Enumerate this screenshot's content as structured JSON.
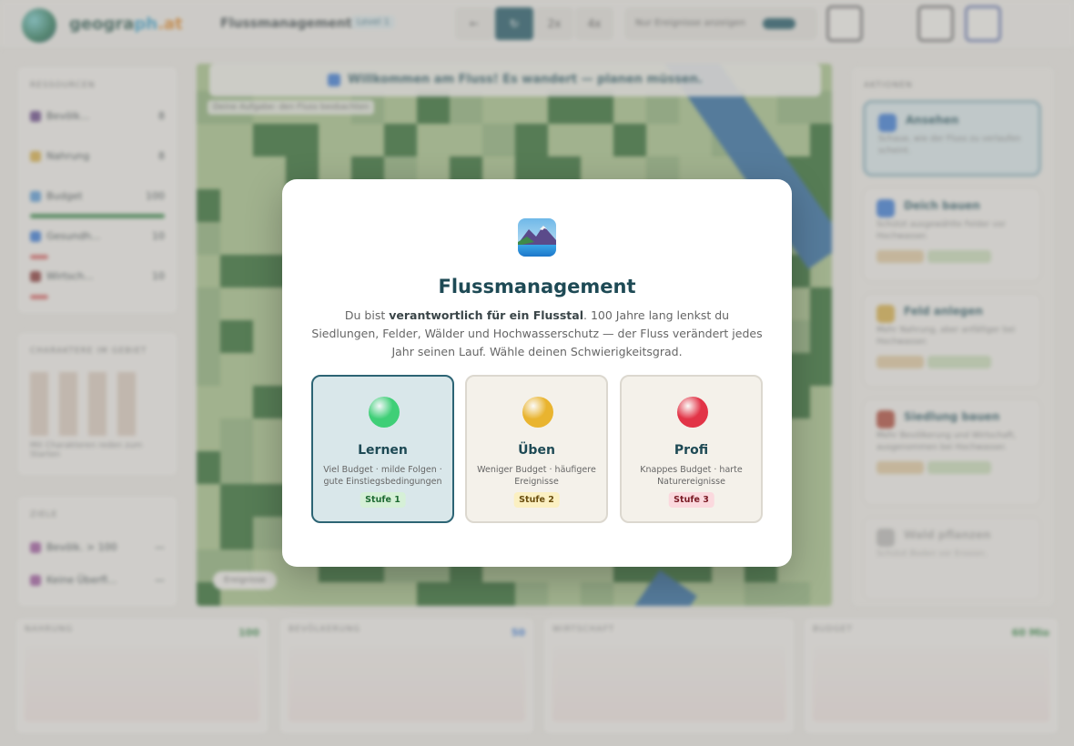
{
  "header": {
    "logo": {
      "a": "geogra",
      "b": "ph",
      "c": ".at"
    },
    "title": "Flussmanagement",
    "badge": "Level 1",
    "controls": [
      "←",
      "↻",
      "2x",
      "4x"
    ],
    "toggle_label": "Nur Ereignisse anzeigen"
  },
  "sidebar": {
    "resources_heading": "RESSOURCEN",
    "resources": [
      {
        "label": "Bevölk...",
        "value": "8",
        "color": "#6a4a8a"
      },
      {
        "label": "Nahrung",
        "value": "8",
        "color": "#d8b04a"
      },
      {
        "label": "Budget",
        "value": "100",
        "color": "#5b9bd5"
      },
      {
        "label": "Gesundh...",
        "value": "10",
        "color": "#3a7ad5"
      },
      {
        "label": "Wirtsch...",
        "value": "10",
        "color": "#8a3a3a"
      }
    ],
    "chars_heading": "CHARAKTERE IM GEBIET",
    "chars_note": "Mit Charakteren reden zum Starten",
    "goals_heading": "ZIELE",
    "goals": [
      {
        "label": "Bevölk. > 100",
        "value": "—"
      },
      {
        "label": "Keine Überfl...",
        "value": "—"
      }
    ]
  },
  "map": {
    "banner": "Willkommen am Fluss! Es wandert — planen müssen.",
    "corner_label": "Deine Aufgabe: den Fluss beobachten",
    "bottom_chip": "Ereignisse"
  },
  "actions": {
    "heading": "AKTIONEN",
    "items": [
      {
        "title": "Ansehen",
        "text": "Schaue, wie der Fluss zu verlaufen scheint."
      },
      {
        "title": "Deich bauen",
        "text": "Schützt ausgewählte Felder vor Hochwasser."
      },
      {
        "title": "Feld anlegen",
        "text": "Mehr Nahrung, aber anfälliger bei Hochwasser."
      },
      {
        "title": "Siedlung bauen",
        "text": "Mehr Bevölkerung und Wirtschaft, ausgenommen bei Hochwasser."
      },
      {
        "title": "Wald pflanzen",
        "text": "Schützt Boden vor Erosion."
      }
    ]
  },
  "bottom": [
    {
      "label": "NAHRUNG",
      "value": "100"
    },
    {
      "label": "BEVÖLKERUNG",
      "value": "50"
    },
    {
      "label": "WIRTSCHAFT",
      "value": ""
    },
    {
      "label": "BUDGET",
      "value": "60 Mio"
    }
  ],
  "modal": {
    "title": "Flussmanagement",
    "desc_pre": "Du bist ",
    "desc_bold": "verantwortlich für ein Flusstal",
    "desc_post": ". 100 Jahre lang lenkst du Siedlungen, Felder, Wälder und Hochwasserschutz — der Fluss verändert jedes Jahr seinen Lauf. Wähle deinen Schwierigkeitsgrad.",
    "levels": [
      {
        "name": "Lernen",
        "desc": "Viel Budget · milde Folgen · gute Einstiegsbedingungen",
        "tag": "Stufe 1",
        "orb": "#3fcf77",
        "tag_bg": "#d6f0d7",
        "tag_fg": "#1e6a32"
      },
      {
        "name": "Üben",
        "desc": "Weniger Budget · häufigere Ereignisse",
        "tag": "Stufe 2",
        "orb": "#e9b42f",
        "tag_bg": "#fbf0c2",
        "tag_fg": "#6a4e0e"
      },
      {
        "name": "Profi",
        "desc": "Knappes Budget · harte Naturereignisse",
        "tag": "Stufe 3",
        "orb": "#e23447",
        "tag_bg": "#fbd9de",
        "tag_fg": "#7a1a24"
      }
    ]
  }
}
